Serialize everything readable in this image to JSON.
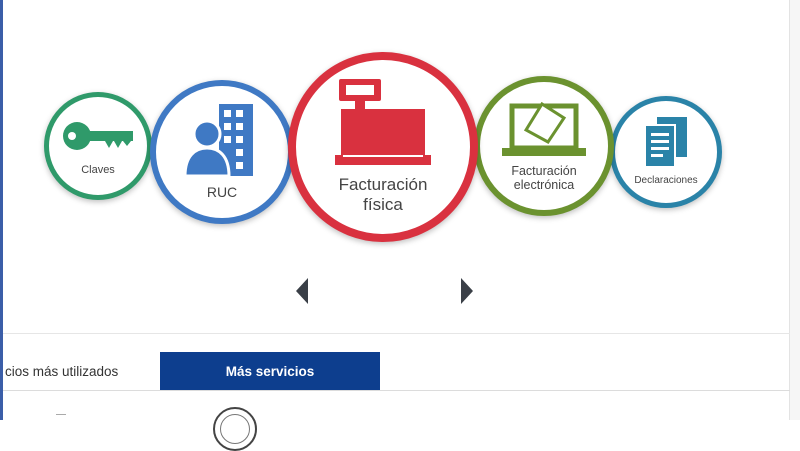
{
  "carousel": {
    "items": [
      {
        "label": "Claves",
        "icon": "key-icon",
        "color": "#2f9a6a"
      },
      {
        "label": "RUC",
        "icon": "user-building-icon",
        "color": "#3f79c4"
      },
      {
        "label_lines": [
          "Facturación",
          "física"
        ],
        "icon": "cash-register-icon",
        "color": "#d9313f"
      },
      {
        "label_lines": [
          "Facturación",
          "electrónica"
        ],
        "icon": "laptop-invoice-icon",
        "color": "#6b922f"
      },
      {
        "label": "Declaraciones",
        "icon": "documents-icon",
        "color": "#2a83a8"
      }
    ]
  },
  "tabs": {
    "inactive_label": "cios más utilizados",
    "active_label": "Más servicios",
    "active_color": "#0d3e8e"
  }
}
